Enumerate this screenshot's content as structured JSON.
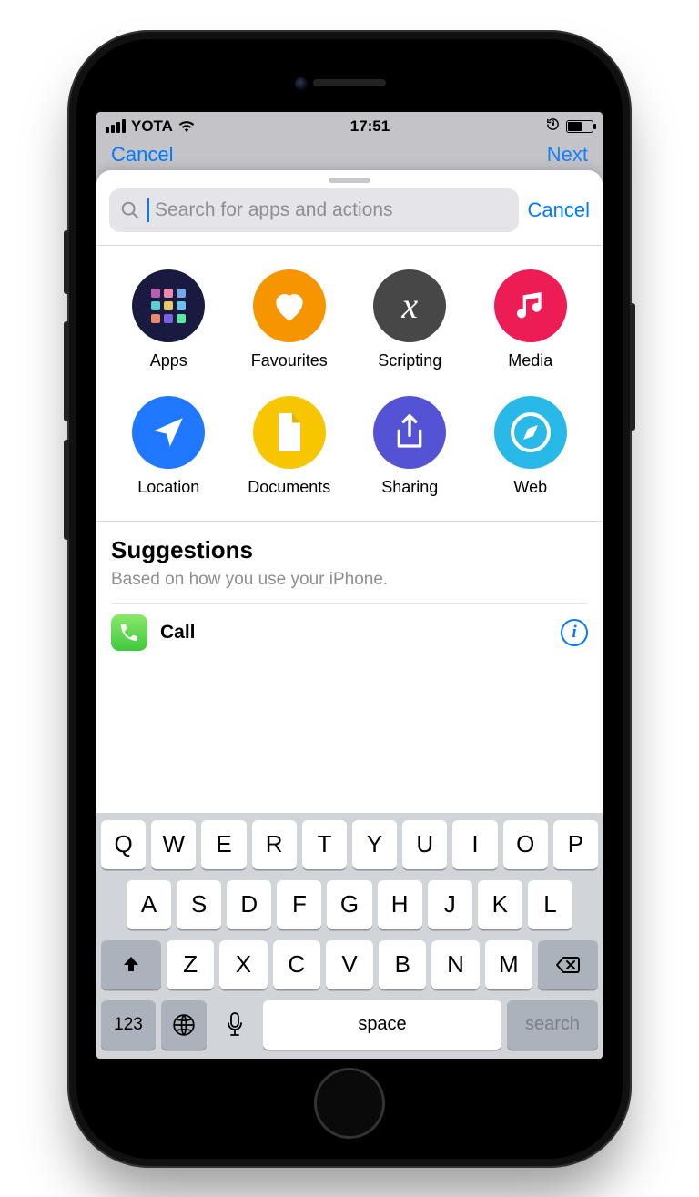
{
  "status": {
    "carrier": "YOTA",
    "time": "17:51"
  },
  "behind_nav": {
    "left": "Cancel",
    "right": "Next"
  },
  "search": {
    "placeholder": "Search for apps and actions",
    "cancel": "Cancel"
  },
  "categories": [
    {
      "label": "Apps"
    },
    {
      "label": "Favourites"
    },
    {
      "label": "Scripting"
    },
    {
      "label": "Media"
    },
    {
      "label": "Location"
    },
    {
      "label": "Documents"
    },
    {
      "label": "Sharing"
    },
    {
      "label": "Web"
    }
  ],
  "suggestions": {
    "title": "Suggestions",
    "subtitle": "Based on how you use your iPhone.",
    "items": [
      {
        "label": "Call"
      }
    ]
  },
  "keyboard": {
    "row1": [
      "Q",
      "W",
      "E",
      "R",
      "T",
      "Y",
      "U",
      "I",
      "O",
      "P"
    ],
    "row2": [
      "A",
      "S",
      "D",
      "F",
      "G",
      "H",
      "J",
      "K",
      "L"
    ],
    "row3": [
      "Z",
      "X",
      "C",
      "V",
      "B",
      "N",
      "M"
    ],
    "numbers": "123",
    "space": "space",
    "search": "search"
  }
}
